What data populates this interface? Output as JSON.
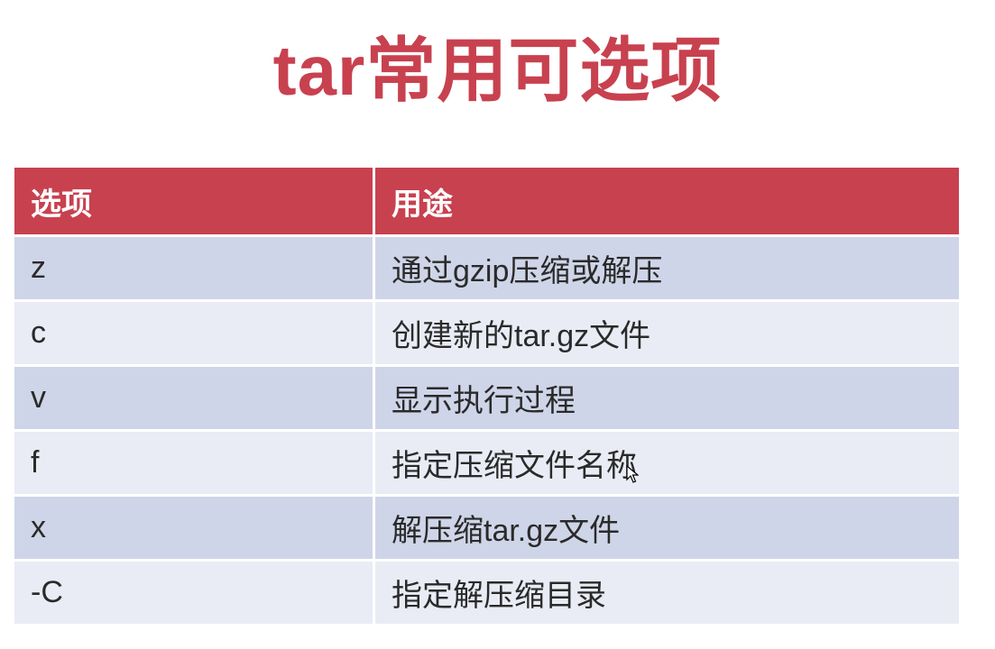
{
  "title": "tar常用可选项",
  "table": {
    "headers": [
      "选项",
      "用途"
    ],
    "rows": [
      {
        "option": "z",
        "use": "通过gzip压缩或解压"
      },
      {
        "option": "c",
        "use": "创建新的tar.gz文件"
      },
      {
        "option": "v",
        "use": "显示执行过程"
      },
      {
        "option": "f",
        "use": "指定压缩文件名称"
      },
      {
        "option": "x",
        "use": "解压缩tar.gz文件"
      },
      {
        "option": "-C",
        "use": "指定解压缩目录"
      }
    ]
  },
  "colors": {
    "accent": "#c8414f",
    "row_dark": "#cfd5e8",
    "row_light": "#e9ecf5"
  },
  "icons": {
    "cursor": "mouse-pointer-icon"
  }
}
